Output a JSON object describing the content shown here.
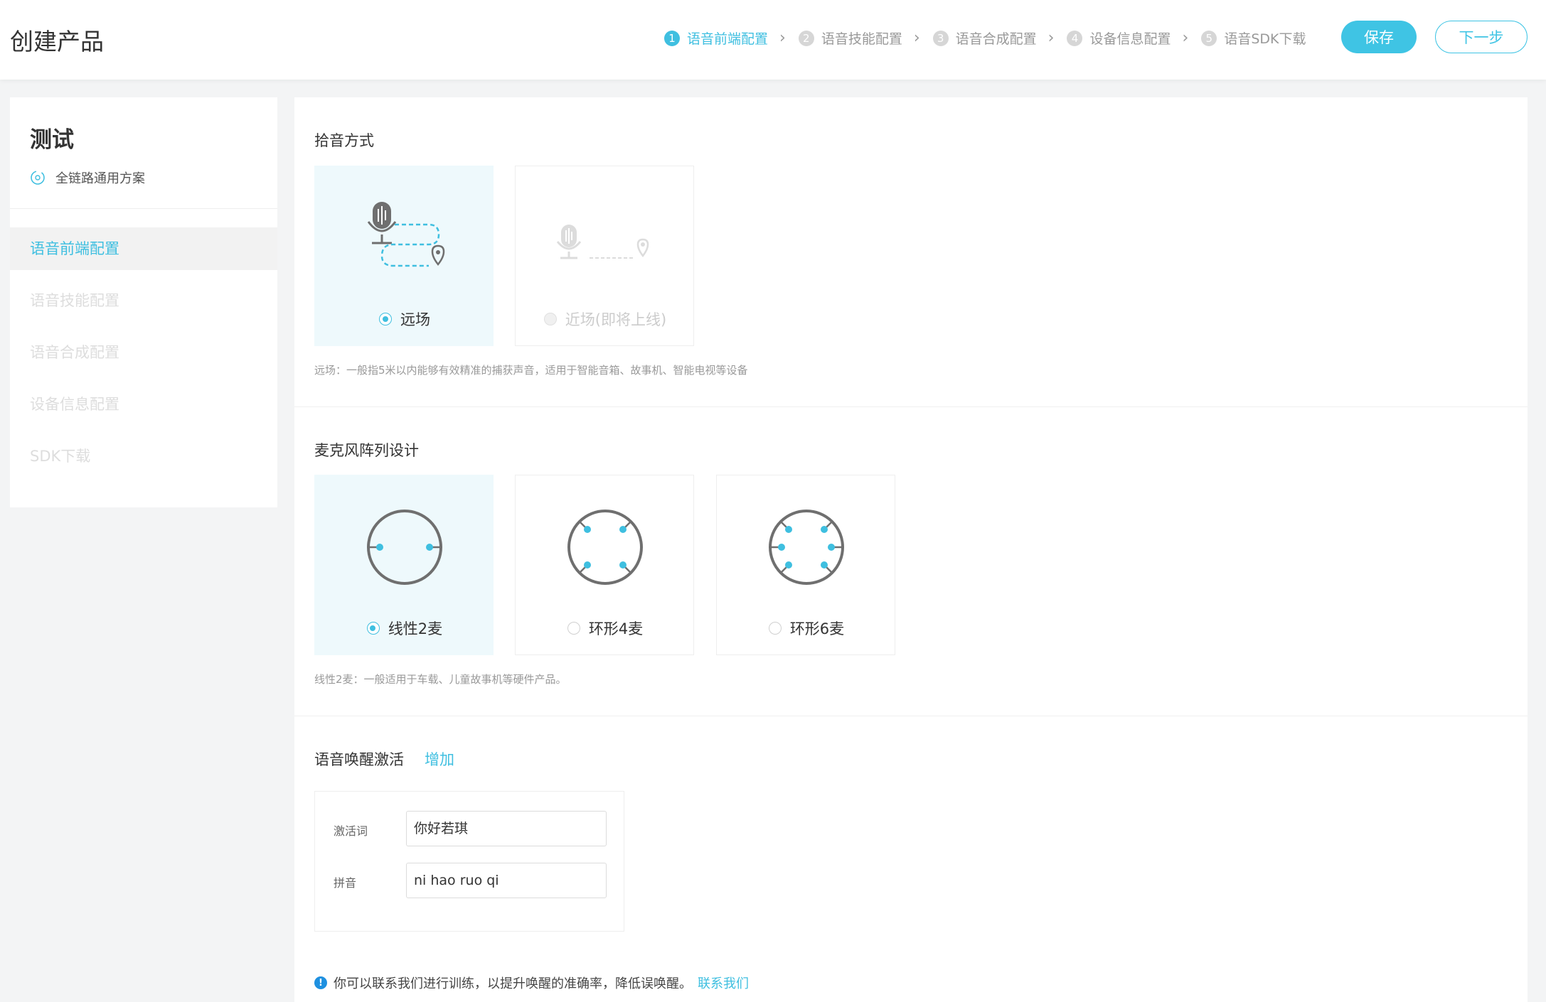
{
  "header": {
    "title": "创建产品",
    "steps": [
      {
        "num": "1",
        "label": "语音前端配置"
      },
      {
        "num": "2",
        "label": "语音技能配置"
      },
      {
        "num": "3",
        "label": "语音合成配置"
      },
      {
        "num": "4",
        "label": "设备信息配置"
      },
      {
        "num": "5",
        "label": "语音SDK下载"
      }
    ],
    "save_label": "保存",
    "next_label": "下一步"
  },
  "sidebar": {
    "project_name": "测试",
    "project_type": "全链路通用方案",
    "items": [
      {
        "label": "语音前端配置"
      },
      {
        "label": "语音技能配置"
      },
      {
        "label": "语音合成配置"
      },
      {
        "label": "设备信息配置"
      },
      {
        "label": "SDK下载"
      }
    ]
  },
  "pickup": {
    "title": "拾音方式",
    "options": [
      {
        "label": "远场",
        "selected": true
      },
      {
        "label": "近场(即将上线)",
        "disabled": true
      }
    ],
    "description": "远场：一般指5米以内能够有效精准的捕获声音，适用于智能音箱、故事机、智能电视等设备"
  },
  "mic_array": {
    "title": "麦克风阵列设计",
    "options": [
      {
        "label": "线性2麦",
        "selected": true
      },
      {
        "label": "环形4麦"
      },
      {
        "label": "环形6麦"
      }
    ],
    "description": "线性2麦：一般适用于车载、儿童故事机等硬件产品。"
  },
  "wakeup": {
    "title": "语音唤醒激活",
    "add_label": "增加",
    "word_label": "激活词",
    "word_value": "你好若琪",
    "pinyin_label": "拼音",
    "pinyin_value": "ni hao ruo qi"
  },
  "tip": {
    "text": "你可以联系我们进行训练，以提升唤醒的准确率，降低误唤醒。",
    "link": "联系我们"
  },
  "colors": {
    "accent": "#3fbfe0",
    "selected_bg": "#eef9fc",
    "page_bg": "#f3f4f5"
  }
}
